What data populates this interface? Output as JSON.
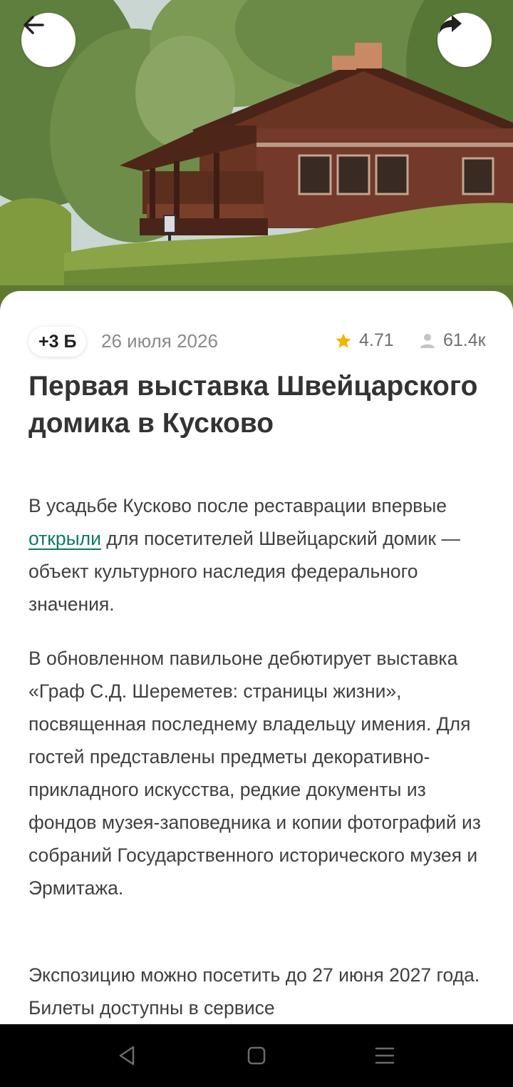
{
  "header": {
    "back_icon": "arrow-left-icon",
    "share_icon": "share-arrow-icon",
    "image_subject": "Swiss house in Kuskovo estate"
  },
  "article": {
    "points": "+3 Б",
    "date": "26 июля 2026",
    "rating": "4.71",
    "views": "61.4к",
    "title": "Первая выставка Швейцарского домика в Кусково",
    "p1_before": "В усадьбе Кусково после реставрации впервые ",
    "p1_link": "открыли",
    "p1_after": " для посетителей Швейцарский домик — объект культурного наследия федерального значения.",
    "p2": "В обновленном павильоне дебютирует выставка «Граф С.Д. Шереметев: страницы жизни», посвященная последнему владельцу имения. Для гостей представлены предметы декоративно-прикладного искусства, редкие документы из фондов музея-заповедника и копии фотографий из собраний Государственного исторического музея и Эрмитажа.",
    "p3": "Экспозицию можно посетить до 27 июня 2027 года. Билеты доступны в сервисе"
  },
  "colors": {
    "link": "#0e7a63",
    "star": "#f5b400",
    "text": "#404040",
    "title": "#333333"
  },
  "system_nav": {
    "back_icon": "triangle-back-icon",
    "home_icon": "square-home-icon",
    "menu_icon": "three-lines-menu-icon"
  }
}
